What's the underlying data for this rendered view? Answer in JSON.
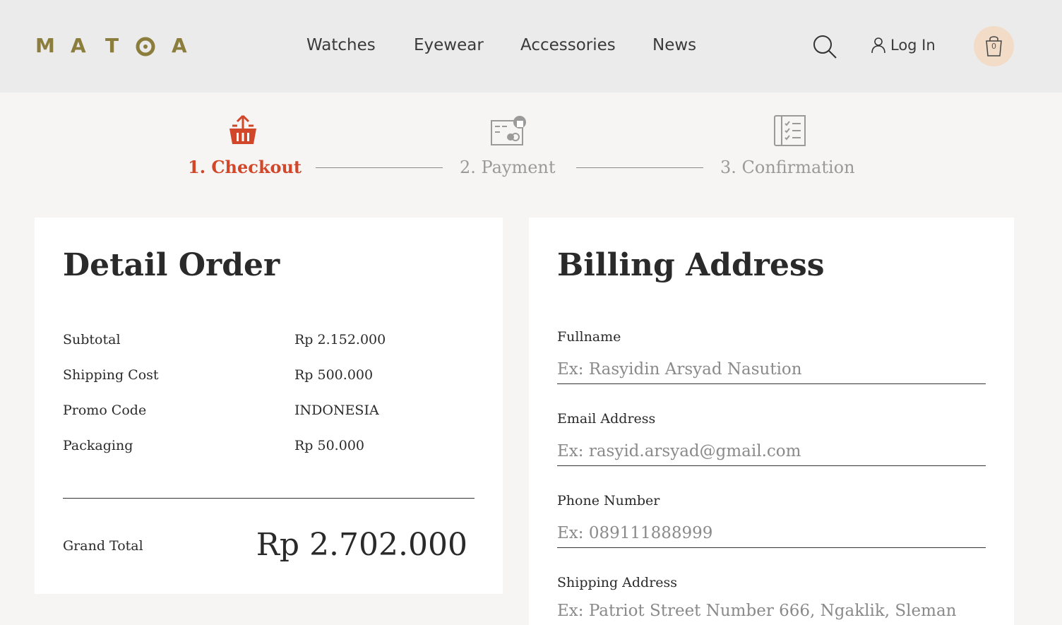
{
  "brand": {
    "logo_letters": [
      "M",
      "A",
      "T",
      "",
      "A"
    ]
  },
  "nav": {
    "items": [
      {
        "label": "Watches"
      },
      {
        "label": "Eyewear"
      },
      {
        "label": "Accessories"
      },
      {
        "label": "News"
      }
    ],
    "login_label": "Log In",
    "cart_count": "0"
  },
  "stepper": {
    "steps": [
      {
        "label": "1. Checkout",
        "icon": "basket-upload-icon",
        "state": "active"
      },
      {
        "label": "2. Payment",
        "icon": "payment-card-icon",
        "state": "inactive"
      },
      {
        "label": "3. Confirmation",
        "icon": "checklist-icon",
        "state": "inactive"
      }
    ]
  },
  "order": {
    "title": "Detail Order",
    "rows": [
      {
        "label": "Subtotal",
        "value": "Rp 2.152.000"
      },
      {
        "label": "Shipping Cost",
        "value": "Rp 500.000"
      },
      {
        "label": "Promo Code",
        "value": "INDONESIA"
      },
      {
        "label": "Packaging",
        "value": "Rp 50.000"
      }
    ],
    "grand_total_label": "Grand Total",
    "grand_total_value": "Rp 2.702.000"
  },
  "billing": {
    "title": "Billing Address",
    "fields": [
      {
        "label": "Fullname",
        "placeholder": "Ex: Rasyidin Arsyad Nasution",
        "value": ""
      },
      {
        "label": "Email Address",
        "placeholder": "Ex: rasyid.arsyad@gmail.com",
        "value": ""
      },
      {
        "label": "Phone Number",
        "placeholder": "Ex: 089111888999",
        "value": ""
      },
      {
        "label": "Shipping Address",
        "placeholder": "Ex: Patriot Street Number 666, Ngaklik, Sleman",
        "value": ""
      }
    ]
  },
  "colors": {
    "accent": "#d2462a",
    "brand": "#8b7d3c",
    "header_bg": "#ebebeb",
    "page_bg": "#f6f5f3",
    "cart_bg": "#f3dcc7",
    "inactive": "#9a9a9a"
  }
}
